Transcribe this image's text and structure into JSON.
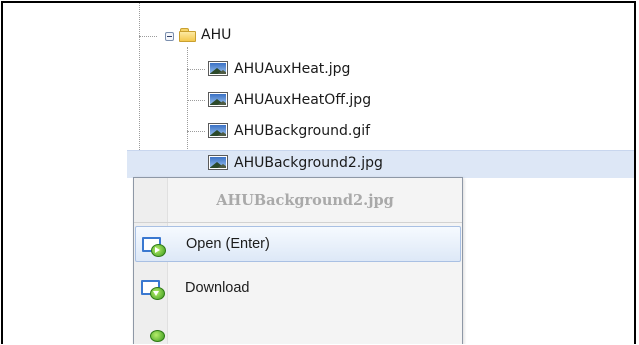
{
  "tree": {
    "folder": {
      "label": "AHU",
      "icon": "folder-open-icon",
      "expanded": true
    },
    "files": [
      {
        "label": "AHUAuxHeat.jpg",
        "icon": "image-file-icon"
      },
      {
        "label": "AHUAuxHeatOff.jpg",
        "icon": "image-file-icon"
      },
      {
        "label": "AHUBackground.gif",
        "icon": "image-file-icon"
      },
      {
        "label": "AHUBackground2.jpg",
        "icon": "image-file-icon",
        "selected": true
      }
    ]
  },
  "context_menu": {
    "header": "AHUBackground2.jpg",
    "items": [
      {
        "label": "Open (Enter)",
        "icon": "open-icon",
        "highlighted": true
      },
      {
        "label": "Download",
        "icon": "download-icon"
      }
    ]
  },
  "colors": {
    "selection": "#dde7f6",
    "menu_background": "#f4f4f4",
    "menu_hover": "#dde8f7",
    "header_text": "#a9a9a9"
  }
}
